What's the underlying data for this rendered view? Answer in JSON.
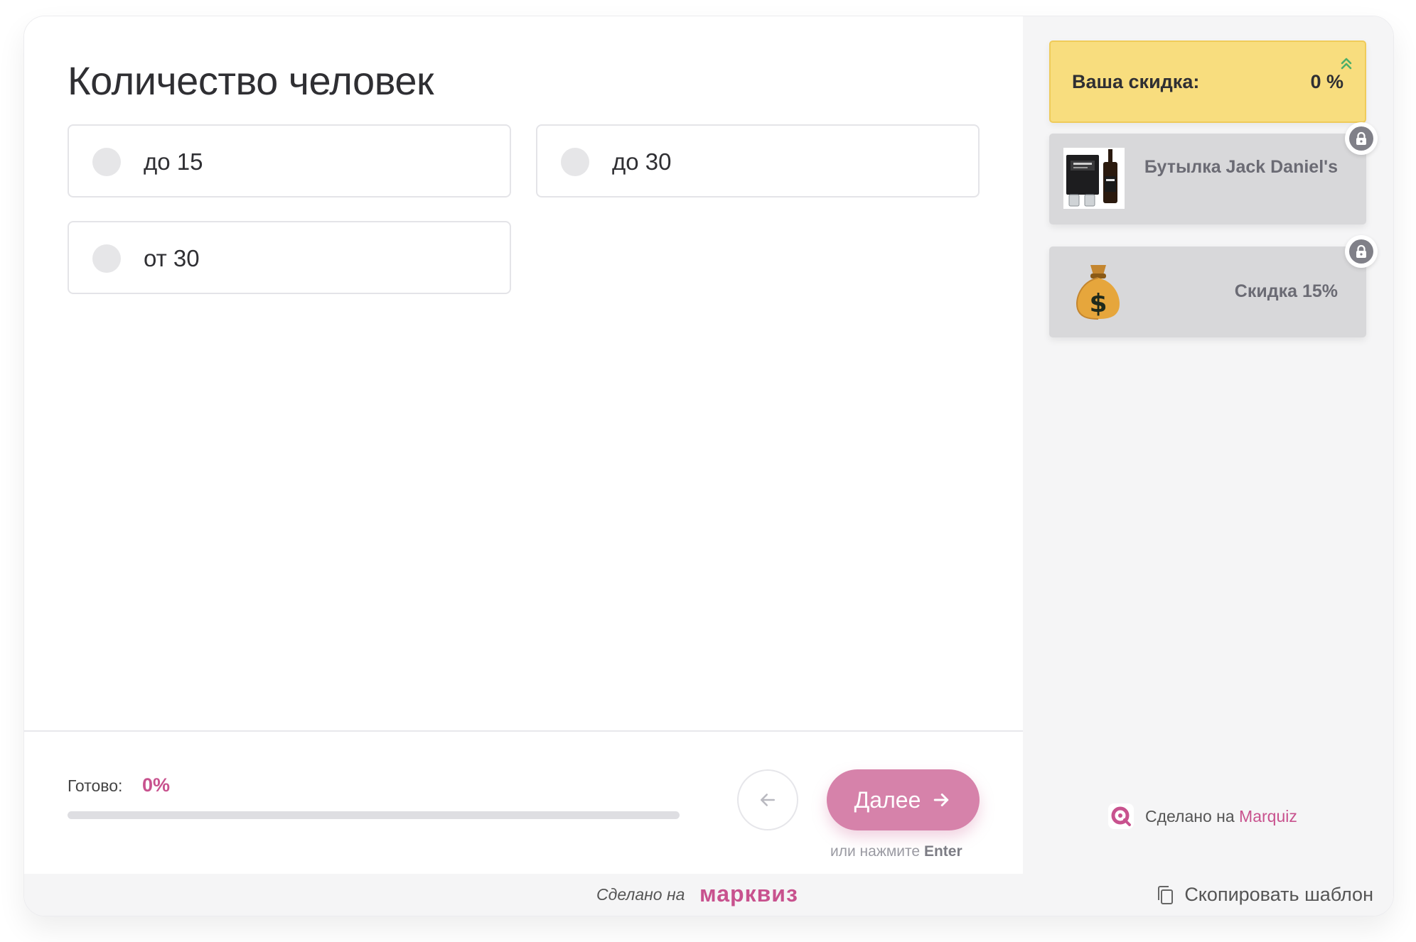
{
  "question": {
    "title": "Количество человек",
    "options": [
      {
        "label": "до 15"
      },
      {
        "label": "до 30"
      },
      {
        "label": "от 30"
      }
    ]
  },
  "progress": {
    "label": "Готово:",
    "value_text": "0%",
    "value": 0
  },
  "navigation": {
    "next_label": "Далее",
    "hint_prefix": "или нажмите",
    "hint_key": "Enter"
  },
  "sidebar": {
    "discount_label": "Ваша скидка:",
    "discount_value": "0 %",
    "bonuses": [
      {
        "label": "Бутылка Jack Daniel's",
        "icon": "whiskey-gift-image"
      },
      {
        "label": "Скидка 15%",
        "icon": "money-bag-icon"
      }
    ],
    "made_prefix": "Сделано на",
    "made_brand": "Marquiz"
  },
  "footer": {
    "made_on": "Сделано на",
    "logo": "марквиз",
    "copy_template": "Скопировать шаблон"
  },
  "colors": {
    "accent": "#c8528e",
    "next_button": "#d682aa",
    "discount_bg": "#f8dd7e",
    "sidebar_bg": "#f5f5f6"
  }
}
